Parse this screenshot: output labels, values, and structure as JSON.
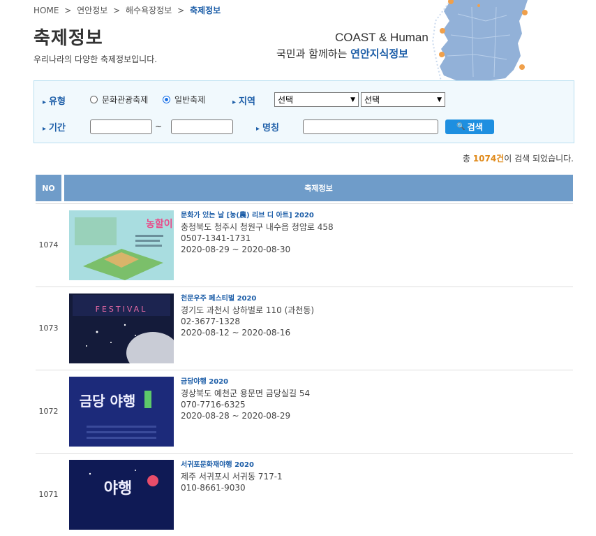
{
  "breadcrumb": {
    "home": "HOME",
    "sep": ">",
    "level1": "연안정보",
    "level2": "해수욕장정보",
    "current": "축제정보"
  },
  "page": {
    "title": "축제정보",
    "subtitle": "우리나라의 다양한 축제정보입니다."
  },
  "brand": {
    "english": "COAST & Human",
    "korean_prefix": "국민과 함께하는 ",
    "korean_highlight": "연안지식정보"
  },
  "search": {
    "type_label": "유형",
    "type_options": [
      "문화관광축제",
      "일반축제"
    ],
    "type_selected": "일반축제",
    "region_label": "지역",
    "region_select1": "선택",
    "region_select2": "선택",
    "period_label": "기간",
    "period_tilde": "~",
    "name_label": "명칭",
    "button_label": "검색"
  },
  "result": {
    "prefix": "총 ",
    "count": "1074건",
    "suffix": "이 검색 되었습니다."
  },
  "table": {
    "col_no": "NO",
    "col_info": "축제정보",
    "rows": [
      {
        "no": "1074",
        "title": "문화가 있는 날 [농(農) 리브 디 아트] 2020",
        "address": "충청북도 청주시 청원구 내수읍 청암로 458",
        "phone": "0507-1341-1731",
        "period": "2020-08-29 ~ 2020-08-30"
      },
      {
        "no": "1073",
        "title": "천문우주 페스티벌 2020",
        "address": "경기도 과천시 상하벌로 110 (과천동)",
        "phone": "02-3677-1328",
        "period": "2020-08-12 ~ 2020-08-16"
      },
      {
        "no": "1072",
        "title": "금당야행 2020",
        "address": "경상북도 예천군 용문면 금당실길 54",
        "phone": "070-7716-6325",
        "period": "2020-08-28 ~ 2020-08-29"
      },
      {
        "no": "1071",
        "title": "서귀포문화재야행 2020",
        "address": "제주 서귀포시 서귀동 717-1",
        "phone": "010-8661-9030",
        "period": ""
      }
    ]
  },
  "thumb_text": {
    "poster1": "농할이",
    "poster2": "FESTIVAL",
    "poster3": "금당 야행",
    "poster4": "야행"
  },
  "colors": {
    "accent": "#1d5ea8",
    "header": "#6f9cc9",
    "button": "#1e8fe0",
    "count": "#e08a1a"
  }
}
